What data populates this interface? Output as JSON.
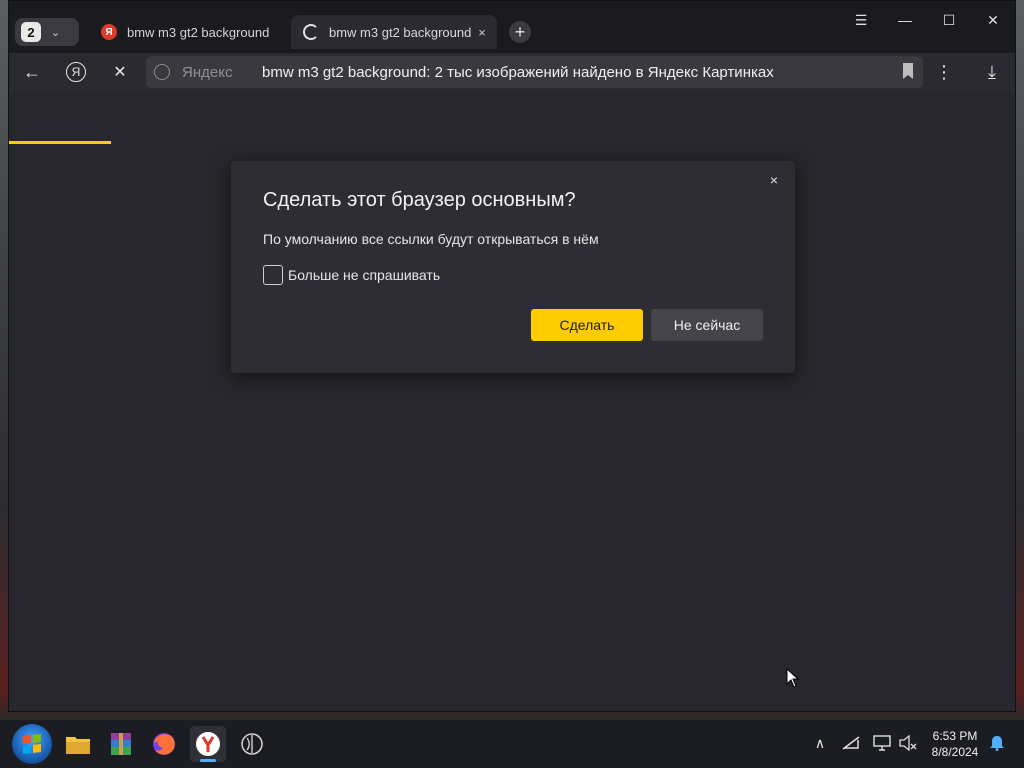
{
  "browser": {
    "tab_count": "2",
    "tabs": [
      {
        "title": "bmw m3 gt2 background",
        "favicon": "yandex-logo",
        "active": false
      },
      {
        "title": "bmw m3 gt2 background",
        "favicon": "loading-spinner",
        "active": true,
        "close": "×"
      }
    ],
    "new_tab": "+",
    "window_controls": {
      "menu": "☰",
      "minimize": "—",
      "maximize": "☐",
      "close": "✕"
    }
  },
  "toolbar": {
    "back": "←",
    "yandex": "Я",
    "stop": "✕",
    "address_host": "Яндекс",
    "address_title": "bmw m3 gt2 background: 2 тыс изображений найдено в Яндекс Картинках",
    "more": "⋮",
    "download": "⤓"
  },
  "dialog": {
    "title": "Сделать этот браузер основным?",
    "text": "По умолчанию все ссылки будут открываться в нём",
    "checkbox_label": "Больше не спрашивать",
    "checkbox_checked": false,
    "primary_button": "Сделать",
    "secondary_button": "Не сейчас",
    "close": "×"
  },
  "taskbar": {
    "apps": [
      "file-explorer",
      "winrar",
      "firefox",
      "yandex-browser",
      "app"
    ],
    "active_app": "yandex-browser",
    "tray": {
      "chevron": "∧"
    },
    "time": "6:53 PM",
    "date": "8/8/2024"
  },
  "colors": {
    "accent": "#ffcc00",
    "dialog_bg": "#2e2d34",
    "page_bg": "#28272d"
  }
}
